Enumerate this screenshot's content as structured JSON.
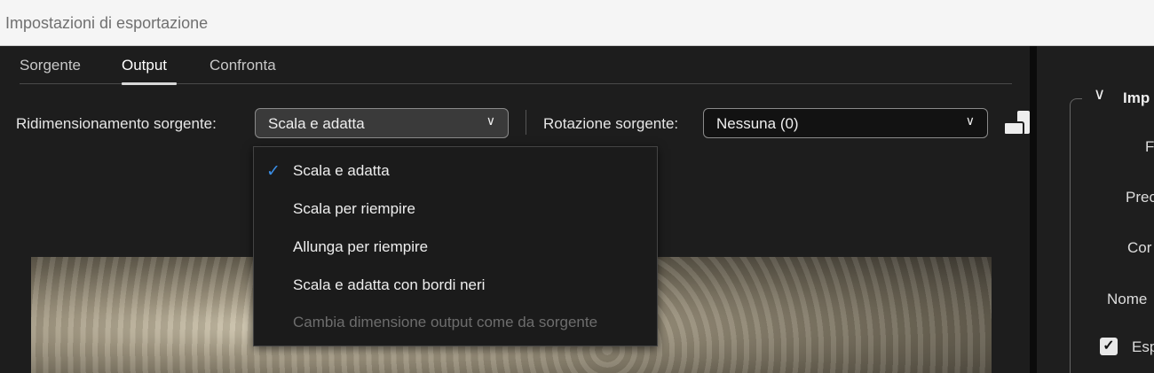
{
  "window": {
    "title": "Impostazioni di esportazione"
  },
  "tabs": [
    {
      "label": "Sorgente"
    },
    {
      "label": "Output",
      "active": true
    },
    {
      "label": "Confronta"
    }
  ],
  "scaling": {
    "label": "Ridimensionamento sorgente:",
    "value": "Scala e adatta"
  },
  "rotation": {
    "label": "Rotazione sorgente:",
    "value": "Nessuna (0)"
  },
  "menu": {
    "items": [
      {
        "label": "Scala e adatta",
        "checked": true
      },
      {
        "label": "Scala per riempire"
      },
      {
        "label": "Allunga per riempire"
      },
      {
        "label": "Scala e adatta con bordi neri"
      },
      {
        "label": "Cambia dimensione output come da sorgente",
        "disabled": true
      }
    ]
  },
  "right_panel": {
    "section": "Imp",
    "rows": [
      "F",
      "Prec",
      "Cor",
      "Nome"
    ],
    "checkbox_label": "Esp",
    "checkbox_checked": true
  },
  "colors": {
    "accent": "#3a8ee6",
    "background": "#1d1d1d"
  }
}
